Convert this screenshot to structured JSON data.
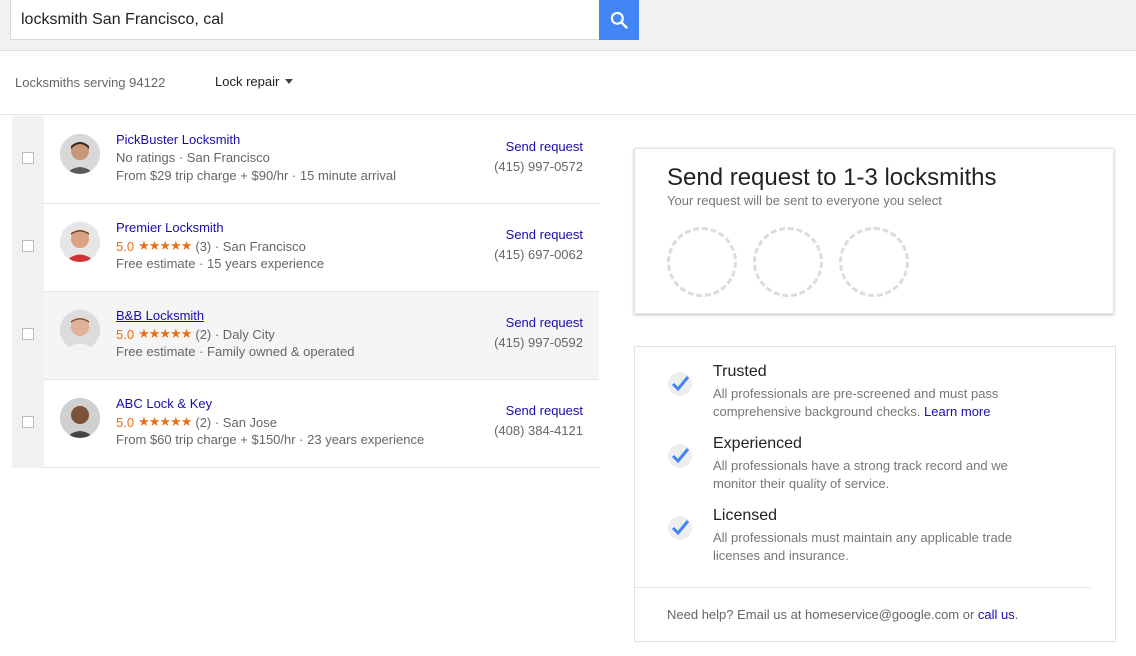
{
  "search": {
    "query": "locksmith San Francisco, cal"
  },
  "filters": {
    "serving": "Locksmiths serving 94122",
    "service": "Lock repair"
  },
  "results": [
    {
      "name": "PickBuster Locksmith",
      "rating": "",
      "stars": "",
      "count": "",
      "location": "No ratings · San Francisco",
      "details": "From $29 trip charge + $90/hr · 15 minute arrival",
      "action": "Send request",
      "phone": "(415) 997-0572"
    },
    {
      "name": "Premier Locksmith",
      "rating": "5.0",
      "stars": "★★★★★",
      "count": "(3) · San Francisco",
      "location": "",
      "details": "Free estimate · 15 years experience",
      "action": "Send request",
      "phone": "(415) 697-0062"
    },
    {
      "name": "B&B Locksmith",
      "rating": "5.0",
      "stars": "★★★★★",
      "count": "(2) · Daly City",
      "location": "",
      "details": "Free estimate · Family owned & operated",
      "action": "Send request",
      "phone": "(415) 997-0592"
    },
    {
      "name": "ABC Lock & Key",
      "rating": "5.0",
      "stars": "★★★★★",
      "count": "(2) · San Jose",
      "location": "",
      "details": "From $60 trip charge + $150/hr · 23 years experience",
      "action": "Send request",
      "phone": "(408) 384-4121"
    }
  ],
  "request": {
    "title": "Send request to 1-3 locksmiths",
    "subtitle": "Your request will be sent to everyone you select"
  },
  "trust": {
    "items": [
      {
        "title": "Trusted",
        "desc": "All professionals are pre-screened and must pass comprehensive background checks.",
        "link": "Learn more"
      },
      {
        "title": "Experienced",
        "desc": "All professionals have a strong track record and we monitor their quality of service."
      },
      {
        "title": "Licensed",
        "desc": "All professionals must maintain any applicable trade licenses and insurance."
      }
    ],
    "help_prefix": "Need help? Email us at homeservice@google.com or",
    "help_link": "call us",
    "help_suffix": "."
  },
  "colors": {
    "accent": "#4285f4",
    "link": "#1a0dab",
    "star": "#e7711b"
  }
}
